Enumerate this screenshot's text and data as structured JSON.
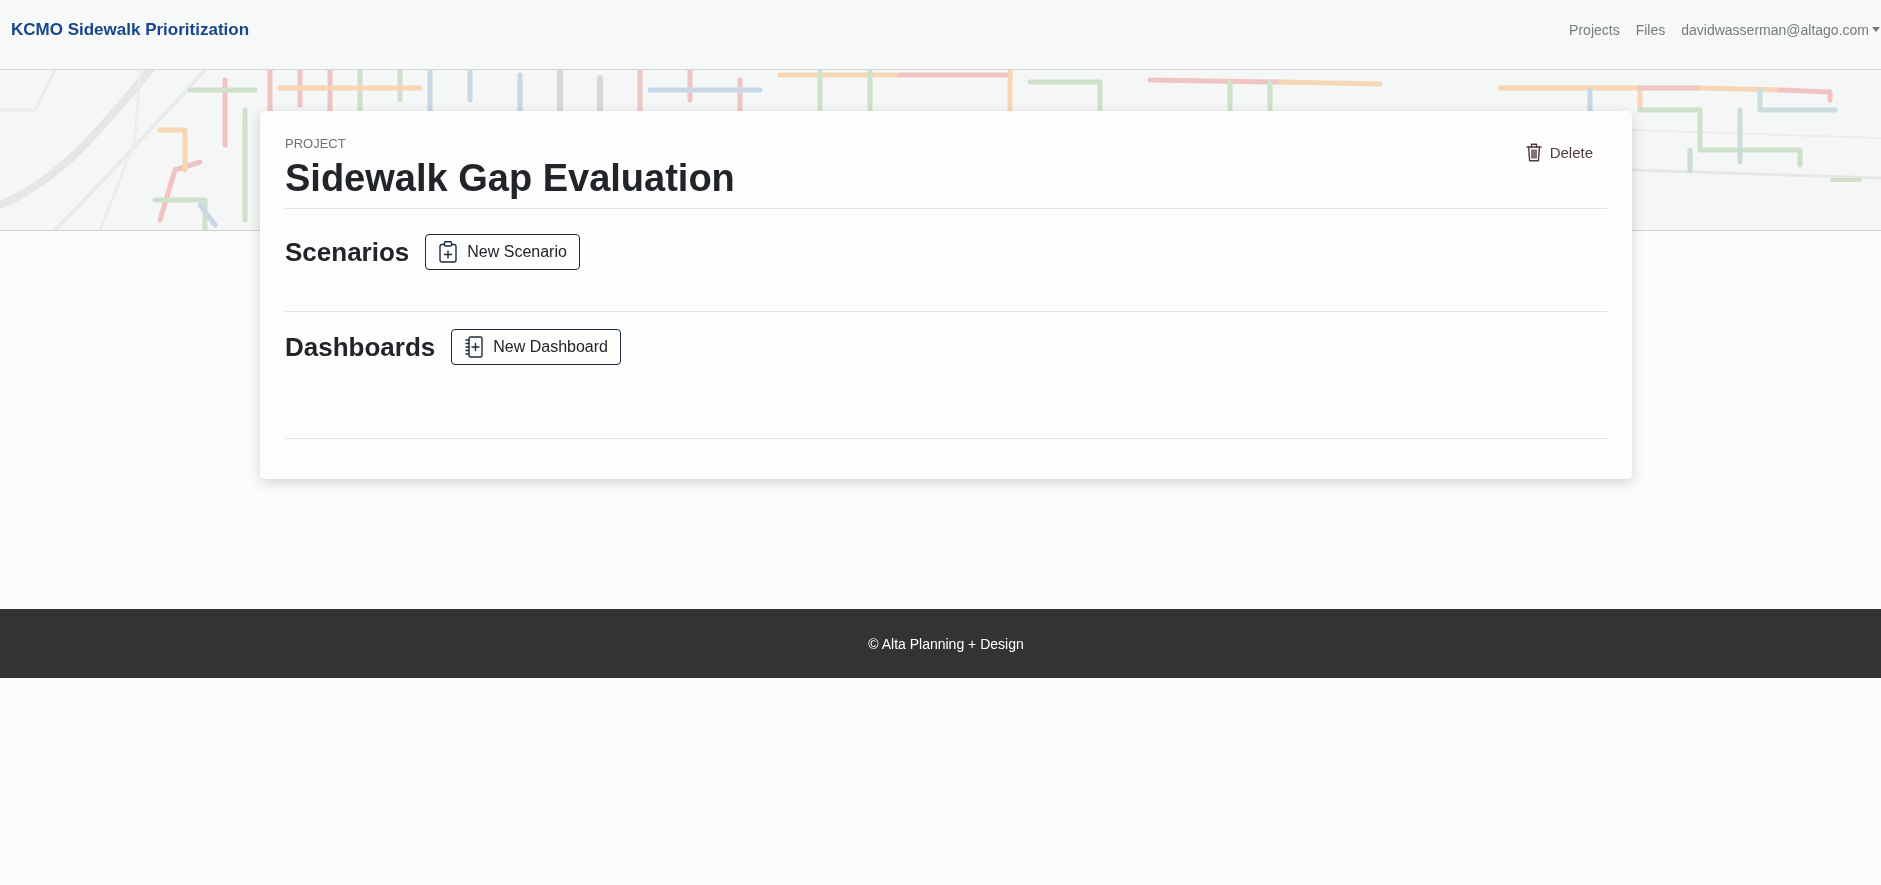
{
  "navbar": {
    "brand": "KCMO Sidewalk Prioritization",
    "links": [
      {
        "label": "Projects"
      },
      {
        "label": "Files"
      }
    ],
    "user_menu": {
      "label": "davidwasserman@altago.com"
    }
  },
  "project": {
    "eyebrow": "PROJECT",
    "title": "Sidewalk Gap Evaluation",
    "delete_button": {
      "label": "Delete"
    }
  },
  "sections": [
    {
      "heading": "Scenarios",
      "button": {
        "kind": "scenario",
        "label": "New Scenario"
      }
    },
    {
      "heading": "Dashboards",
      "button": {
        "kind": "dashboard",
        "label": "New Dashboard"
      }
    }
  ],
  "footer": {
    "text": "© Alta Planning + Design"
  }
}
